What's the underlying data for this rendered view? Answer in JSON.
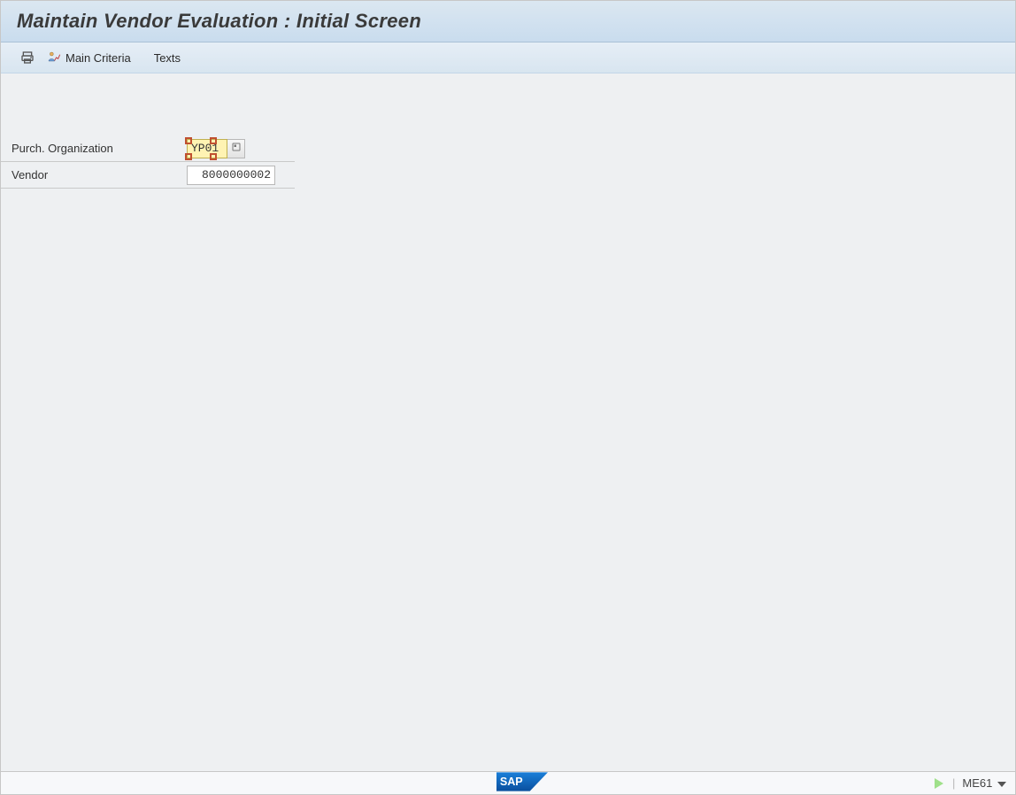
{
  "title": "Maintain Vendor Evaluation : Initial Screen",
  "toolbar": {
    "print_icon": "print",
    "main_criteria_label": "Main Criteria",
    "texts_label": "Texts"
  },
  "form": {
    "purch_org": {
      "label": "Purch. Organization",
      "value": "YP01"
    },
    "vendor": {
      "label": "Vendor",
      "value": "8000000002"
    }
  },
  "footer": {
    "logo_text": "SAP",
    "tcode": "ME61"
  }
}
